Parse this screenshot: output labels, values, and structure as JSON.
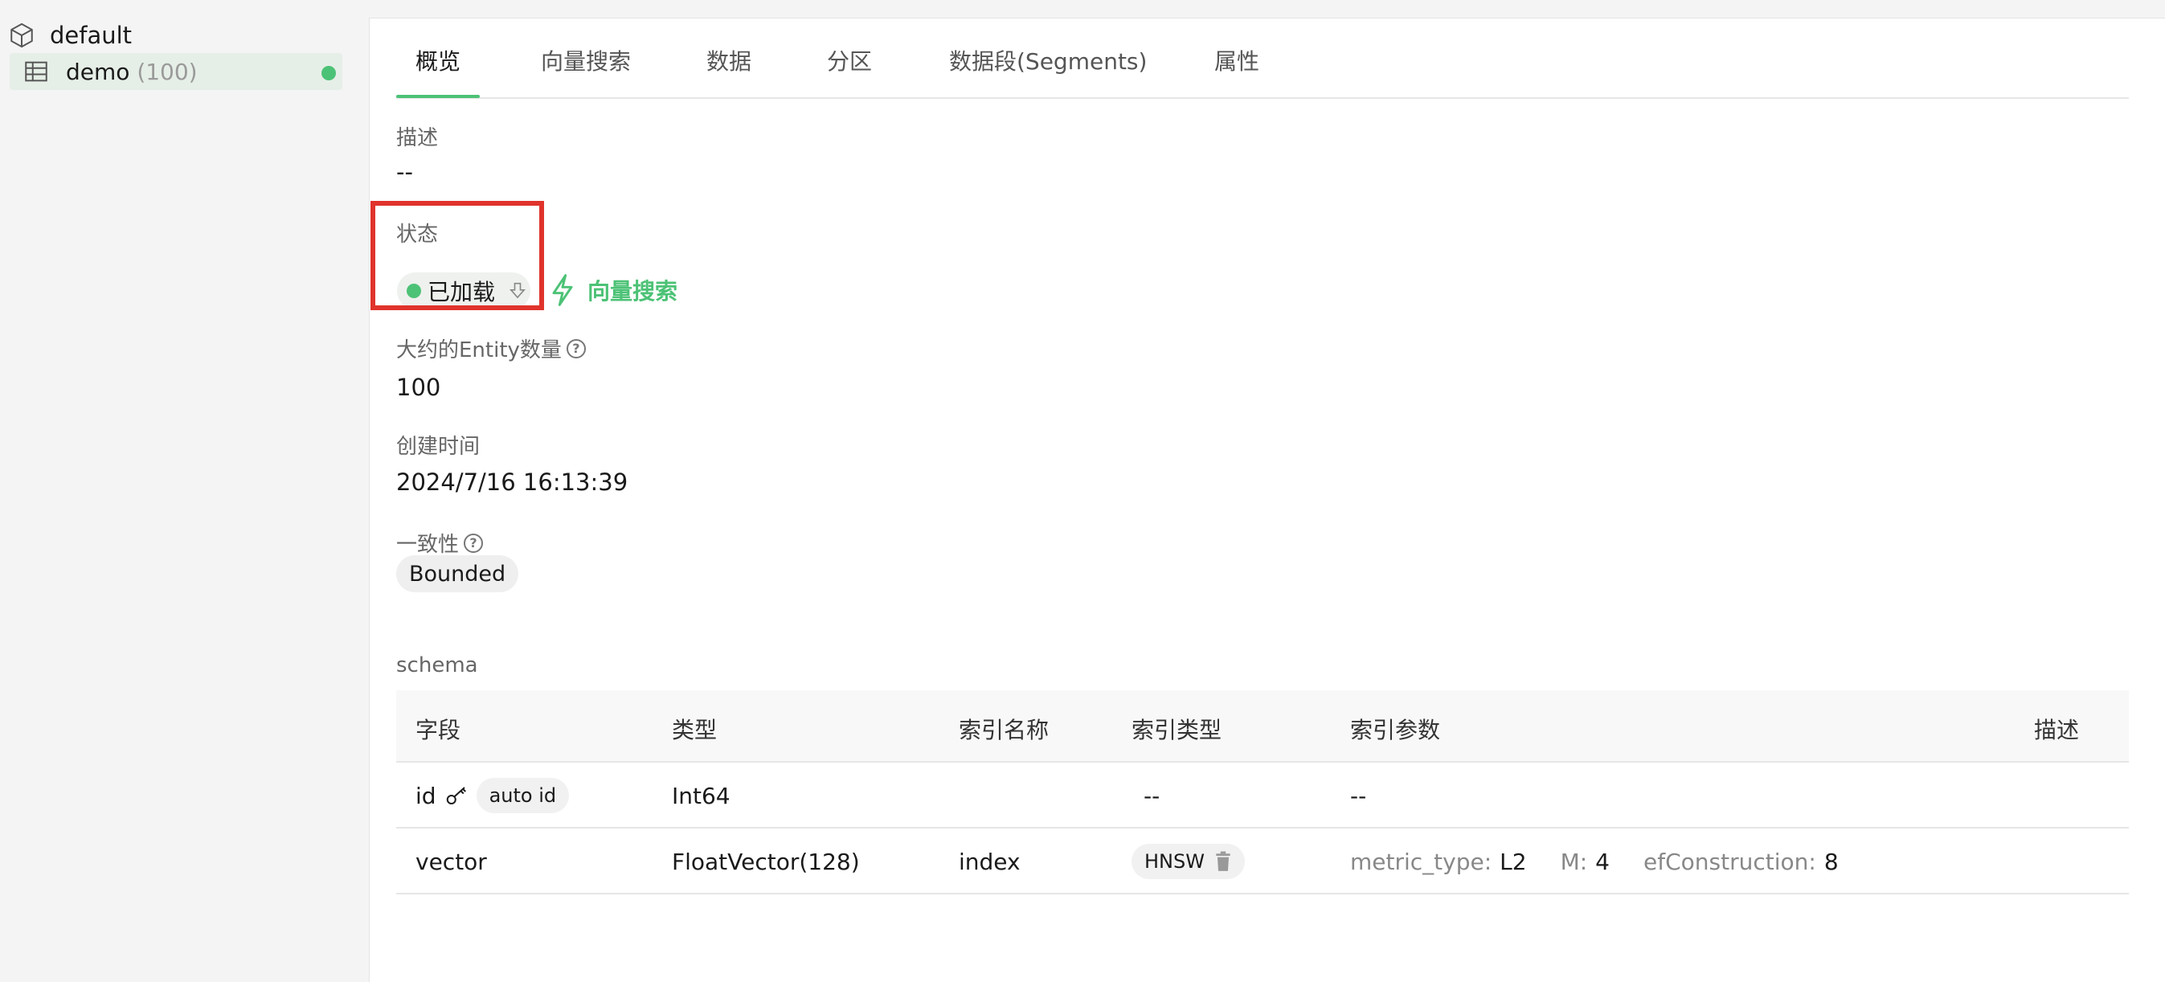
{
  "sidebar": {
    "database": "default",
    "collection": {
      "name": "demo",
      "count": "(100)",
      "status_color": "#4cc276"
    }
  },
  "tabs": [
    {
      "label": "概览",
      "active": true
    },
    {
      "label": "向量搜索"
    },
    {
      "label": "数据"
    },
    {
      "label": "分区"
    },
    {
      "label": "数据段(Segments)"
    },
    {
      "label": "属性"
    }
  ],
  "overview": {
    "description_label": "描述",
    "description_value": "--",
    "status_label": "状态",
    "status_value": "已加载",
    "search_link": "向量搜索",
    "entity_label": "大约的Entity数量",
    "entity_value": "100",
    "created_label": "创建时间",
    "created_value": "2024/7/16 16:13:39",
    "consistency_label": "一致性",
    "consistency_value": "Bounded"
  },
  "schema": {
    "title": "schema",
    "headers": [
      "字段",
      "类型",
      "索引名称",
      "索引类型",
      "索引参数",
      "描述"
    ],
    "rows": [
      {
        "field": "id",
        "badge": "auto id",
        "type": "Int64",
        "index_name": "",
        "index_type": "--",
        "index_params": "--"
      },
      {
        "field": "vector",
        "type": "FloatVector(128)",
        "index_name": "index",
        "index_type": "HNSW",
        "params": [
          {
            "key": "metric_type:",
            "value": "L2"
          },
          {
            "key": "M:",
            "value": "4"
          },
          {
            "key": "efConstruction:",
            "value": "8"
          }
        ]
      }
    ]
  },
  "colors": {
    "accent": "#4cc276",
    "highlight_box": "#e0332c"
  }
}
